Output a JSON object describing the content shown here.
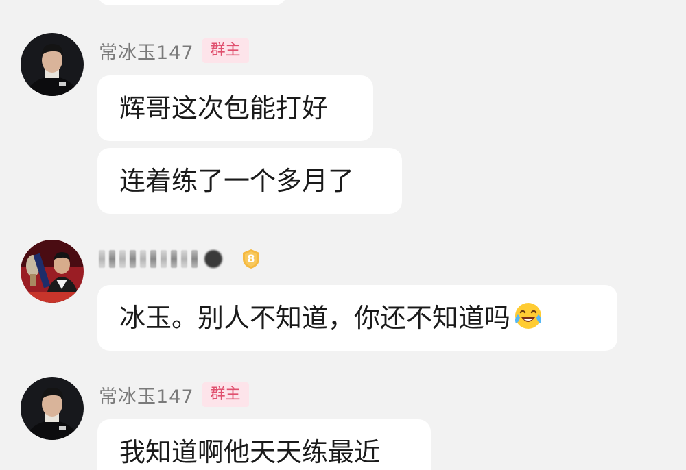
{
  "messages": [
    {
      "sender": "常冰玉147",
      "role_badge": "群主",
      "bubbles": [
        "辉哥这次包能打好",
        "连着练了一个多月了"
      ]
    },
    {
      "sender_level": "8",
      "bubbles": [
        "冰玉。别人不知道，你还不知道吗"
      ],
      "emoji": "laughing-crying-emoji"
    },
    {
      "sender": "常冰玉147",
      "role_badge": "群主",
      "bubbles": [
        "我知道啊他天天练最近"
      ]
    }
  ],
  "colors": {
    "background": "#f2f2f2",
    "bubble": "#ffffff",
    "sender_name": "#7a7a7a",
    "role_badge_bg": "#fde4ea",
    "role_badge_text": "#e0506e",
    "level_badge": "#f5b940"
  }
}
